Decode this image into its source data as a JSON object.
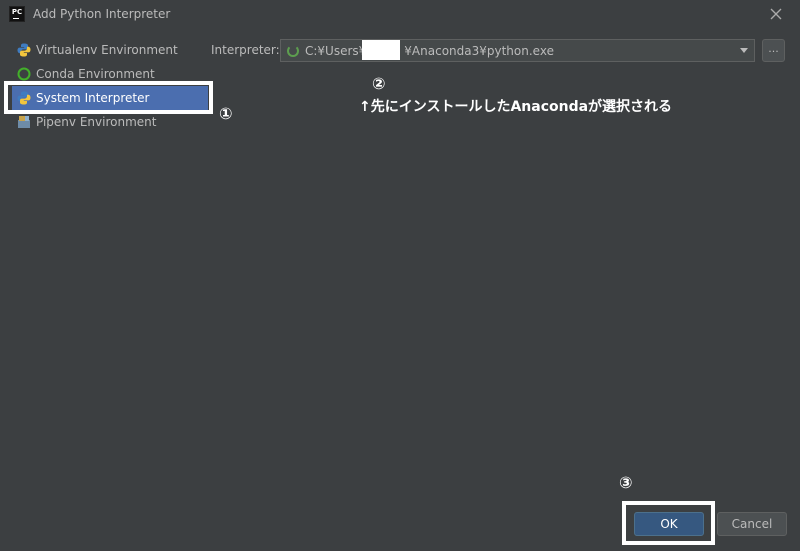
{
  "window": {
    "title": "Add Python Interpreter",
    "app_icon_text": "PC"
  },
  "sidebar": {
    "items": [
      {
        "label": "Virtualenv Environment",
        "icon": "python-icon"
      },
      {
        "label": "Conda Environment",
        "icon": "conda-icon"
      },
      {
        "label": "System Interpreter",
        "icon": "python-icon",
        "selected": true
      },
      {
        "label": "Pipenv Environment",
        "icon": "pipenv-icon"
      }
    ]
  },
  "interpreter": {
    "label": "Interpreter:",
    "path_prefix": "C:¥Users¥",
    "path_suffix": "¥Anaconda3¥python.exe",
    "browse_label": "..."
  },
  "annotations": {
    "marker_1": "①",
    "marker_2": "②",
    "marker_3": "③",
    "note": "↑先にインストールしたAnacondaが選択される"
  },
  "footer": {
    "ok_label": "OK",
    "cancel_label": "Cancel"
  },
  "colors": {
    "background": "#3c3f41",
    "selection": "#4b6eaf",
    "ok_button": "#365880",
    "annotation": "#ffffff"
  }
}
